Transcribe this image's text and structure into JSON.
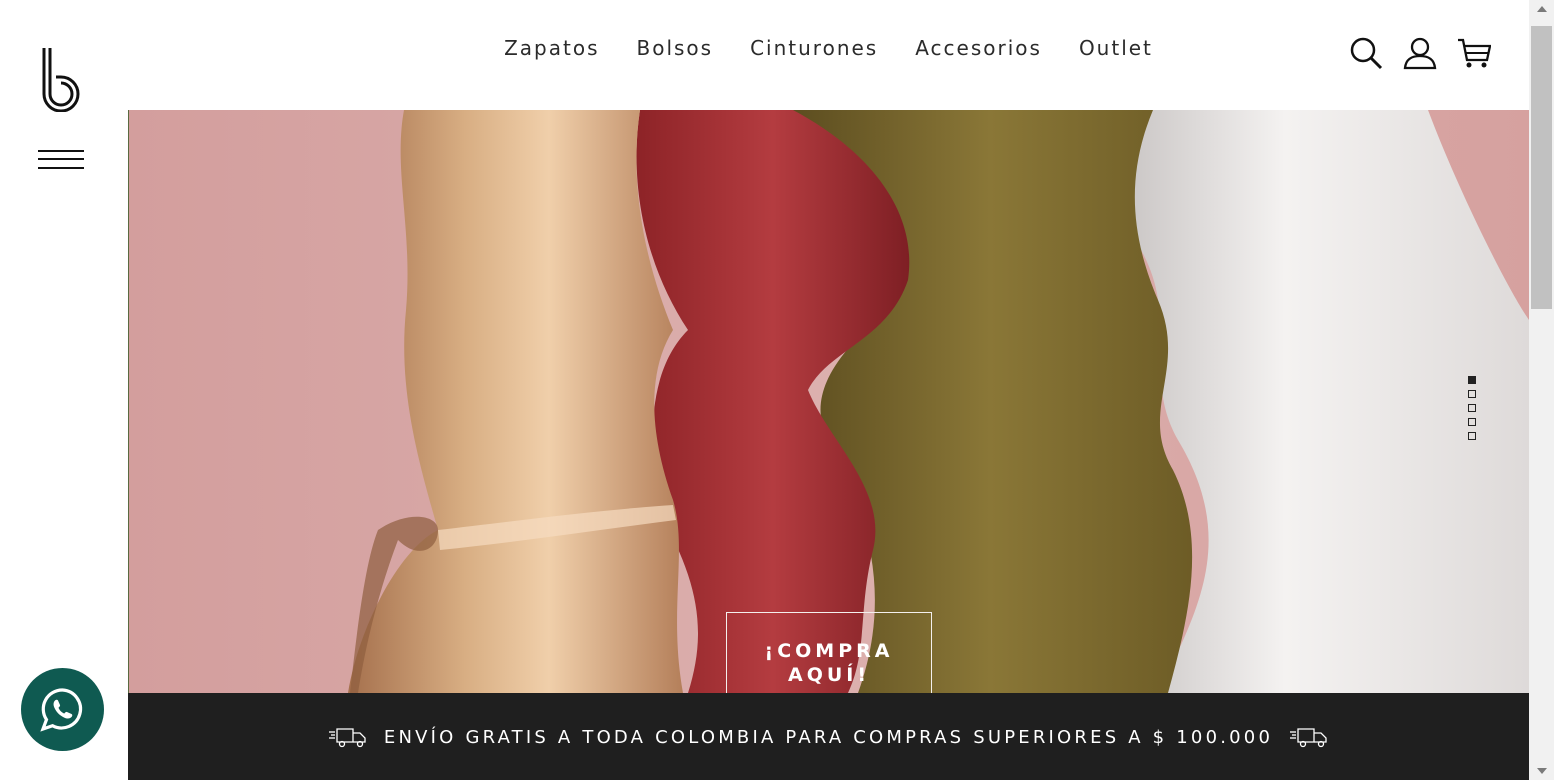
{
  "brand": {
    "logo_icon": "b-logo-icon"
  },
  "nav": {
    "menu": [
      "Zapatos",
      "Bolsos",
      "Cinturones",
      "Accesorios",
      "Outlet"
    ],
    "icons": [
      "search-icon",
      "user-icon",
      "cart-icon"
    ]
  },
  "hero": {
    "cta_line1": "¡COMPRA",
    "cta_line2": "AQUÍ!",
    "slides_total": 5,
    "active_slide": 1,
    "colors": {
      "background": "#d7a7a5",
      "gold": "#c99563",
      "red": "#a8343a",
      "olive": "#7d6a2c",
      "white": "#efecea"
    }
  },
  "shipping_bar": {
    "text": "ENVÍO GRATIS A TODA COLOMBIA PARA COMPRAS SUPERIORES A $ 100.000",
    "icon": "truck-icon"
  },
  "whatsapp": {
    "icon": "whatsapp-icon",
    "color": "#0f5a51"
  }
}
